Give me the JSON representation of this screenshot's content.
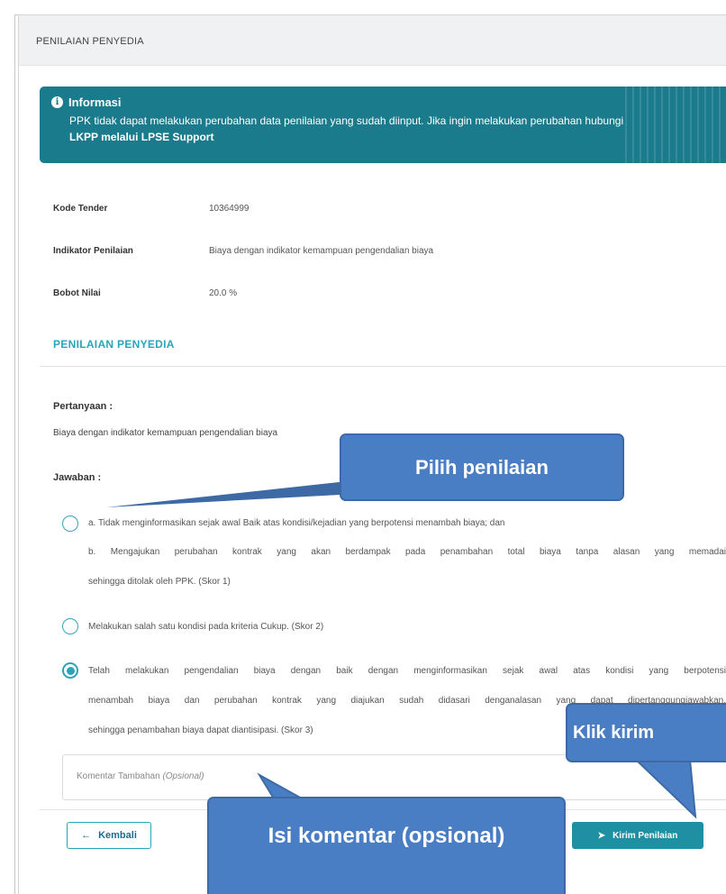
{
  "header": {
    "title": "PENILAIAN PENYEDIA"
  },
  "info": {
    "title": "Informasi",
    "line1": "PPK tidak dapat melakukan perubahan data penilaian yang sudah diinput. Jika ingin melakukan perubahan hubungi",
    "line2": "LKPP melalui LPSE Support"
  },
  "fields": [
    {
      "label": "Kode Tender",
      "value": "10364999"
    },
    {
      "label": "Indikator Penilaian",
      "value": "Biaya dengan indikator kemampuan pengendalian biaya"
    },
    {
      "label": "Bobot Nilai",
      "value": "20.0 %"
    }
  ],
  "section_title": "PENILAIAN PENYEDIA",
  "question": {
    "label": "Pertanyaan :",
    "text": "Biaya dengan indikator kemampuan pengendalian biaya"
  },
  "answer_label": "Jawaban :",
  "options": [
    {
      "lines": [
        "a. Tidak menginformasikan sejak awal Baik atas kondisi/kejadian yang berpotensi menambah biaya; dan",
        "b. Mengajukan perubahan kontrak yang akan berdampak pada penambahan total biaya tanpa alasan yang memadai",
        "sehingga ditolak oleh PPK. (Skor 1)"
      ],
      "checked": false
    },
    {
      "lines": [
        "Melakukan salah satu kondisi pada kriteria Cukup. (Skor 2)"
      ],
      "checked": false
    },
    {
      "lines": [
        "Telah melakukan pengendalian biaya dengan baik dengan menginformasikan sejak awal atas kondisi yang berpotensi",
        "menambah biaya dan perubahan kontrak yang diajukan sudah didasari denganalasan yang dapat dipertanggungjawabkan,",
        "sehingga penambahan biaya dapat diantisipasi. (Skor 3)"
      ],
      "checked": true
    }
  ],
  "comment": {
    "placeholder": "Komentar Tambahan",
    "placeholder_note": "(Opsional)"
  },
  "buttons": {
    "back": "Kembali",
    "send": "Kirim Penilaian"
  },
  "callouts": {
    "choose": "Pilih penilaian",
    "send": "Klik kirim",
    "comment": "Isi komentar (opsional)"
  },
  "colors": {
    "info_bg": "#1a7b8d",
    "accent": "#2aa5b8",
    "callout": "#4a7ec4"
  }
}
